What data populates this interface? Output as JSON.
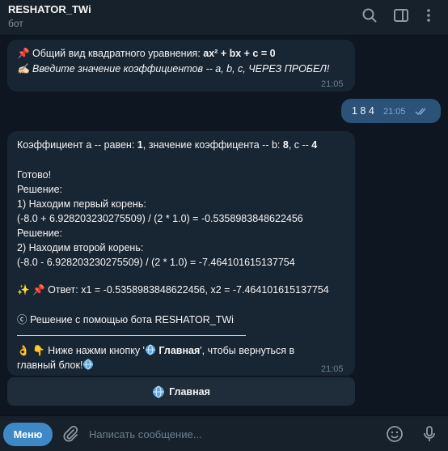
{
  "header": {
    "title": "RESHATOR_TWi",
    "subtitle": "бот"
  },
  "messages": {
    "m1": {
      "line1_prefix": "📌 Общий вид квадратного уравнения: ",
      "line1_bold": "ax² + bx + c = 0",
      "line2": "✍🏻 Введите значение коэффициентов -- a, b, c, ЧЕРЕЗ ПРОБЕЛ!",
      "time": "21:05"
    },
    "m2": {
      "text": "1 8 4",
      "time": "21:05"
    },
    "m3": {
      "l1_a": "Коэффициент a -- равен: ",
      "l1_b": "1",
      "l1_c": ", значение коэффицента -- b: ",
      "l1_d": "8",
      "l1_e": ", c -- ",
      "l1_f": "4",
      "ready": "Готово!",
      "solution1": "Решение:",
      "root1_label": "1) Находим первый корень:",
      "root1_formula": "(-8.0 + 6.928203230275509) / (2 * 1.0) = -0.5358983848622456",
      "solution2": "Решение:",
      "root2_label": "2) Находим второй корень:",
      "root2_formula": "(-8.0 - 6.928203230275509) / (2 * 1.0) = -7.464101615137754",
      "answer": "✨ 📌 Ответ: x1 = -0.5358983848622456, x2 = -7.464101615137754",
      "credit": "ⓒ Решение с помощью бота RESHATOR_TWi",
      "hint_prefix": "👌 👇 Ниже нажми кнопку '",
      "hint_bold": " Главная",
      "hint_suffix": "', чтобы вернуться в",
      "hint_line2": "главный блок!",
      "time": "21:05"
    }
  },
  "keyboard": {
    "main_button": "Главная"
  },
  "composer": {
    "menu_label": "Меню",
    "placeholder": "Написать сообщение..."
  },
  "colors": {
    "background": "#0e1621",
    "incoming_bubble": "#182533",
    "outgoing_bubble": "#2b5278",
    "accent": "#3e88c7"
  }
}
